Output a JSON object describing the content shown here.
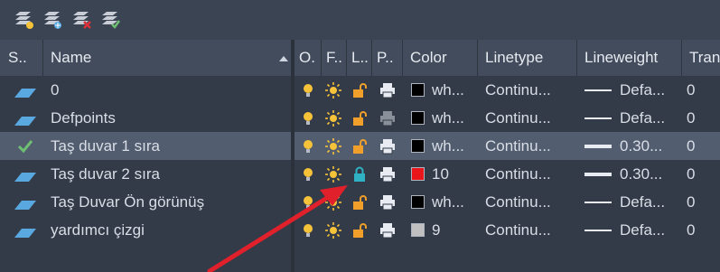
{
  "colors": {
    "background": "#3b4453",
    "panel": "#333b48",
    "header": "#434c5c",
    "selected_row": "#525d70",
    "layer_blue": "#5aa8e0",
    "current_check": "#6fbf73",
    "bulb": "#f5c23a",
    "sun": "#f5c23a",
    "lock_open": "#f0a02a",
    "lock_closed": "#2fb3c4",
    "annotation_arrow": "#e0202a"
  },
  "toolbar": {
    "buttons": [
      {
        "name": "new-layer-icon"
      },
      {
        "name": "new-layer-vp-frozen-icon"
      },
      {
        "name": "delete-layer-icon"
      },
      {
        "name": "set-current-layer-icon"
      }
    ]
  },
  "headers": {
    "status": "S..",
    "name": "Name",
    "on": "O.",
    "freeze": "F..",
    "lock": "L..",
    "plot": "P..",
    "color": "Color",
    "linetype": "Linetype",
    "lineweight": "Lineweight",
    "transparency": "Tran"
  },
  "layers": [
    {
      "name": "0",
      "current": false,
      "on": true,
      "thawed": true,
      "locked": false,
      "plot": true,
      "color_hex": "#000000",
      "color_label": "wh...",
      "linetype": "Continu...",
      "lineweight": "Defa...",
      "lineweight_bold": false,
      "transparency": "0"
    },
    {
      "name": "Defpoints",
      "current": false,
      "on": true,
      "thawed": true,
      "locked": false,
      "plot": false,
      "color_hex": "#000000",
      "color_label": "wh...",
      "linetype": "Continu...",
      "lineweight": "Defa...",
      "lineweight_bold": false,
      "transparency": "0"
    },
    {
      "name": "Taş duvar 1 sıra",
      "current": true,
      "on": true,
      "thawed": true,
      "locked": false,
      "plot": true,
      "color_hex": "#000000",
      "color_label": "wh...",
      "linetype": "Continu...",
      "lineweight": "0.30...",
      "lineweight_bold": true,
      "transparency": "0"
    },
    {
      "name": "Taş duvar 2 sıra",
      "current": false,
      "on": true,
      "thawed": true,
      "locked": true,
      "plot": true,
      "color_hex": "#e8161b",
      "color_label": "10",
      "linetype": "Continu...",
      "lineweight": "0.30...",
      "lineweight_bold": true,
      "transparency": "0"
    },
    {
      "name": "Taş Duvar Ön görünüş",
      "current": false,
      "on": true,
      "thawed": true,
      "locked": false,
      "plot": true,
      "color_hex": "#000000",
      "color_label": "wh...",
      "linetype": "Continu...",
      "lineweight": "Defa...",
      "lineweight_bold": false,
      "transparency": "0"
    },
    {
      "name": "yardımcı çizgi",
      "current": false,
      "on": true,
      "thawed": true,
      "locked": false,
      "plot": true,
      "color_hex": "#c0c0c0",
      "color_label": "9",
      "linetype": "Continu...",
      "lineweight": "Defa...",
      "lineweight_bold": false,
      "transparency": "0"
    }
  ]
}
